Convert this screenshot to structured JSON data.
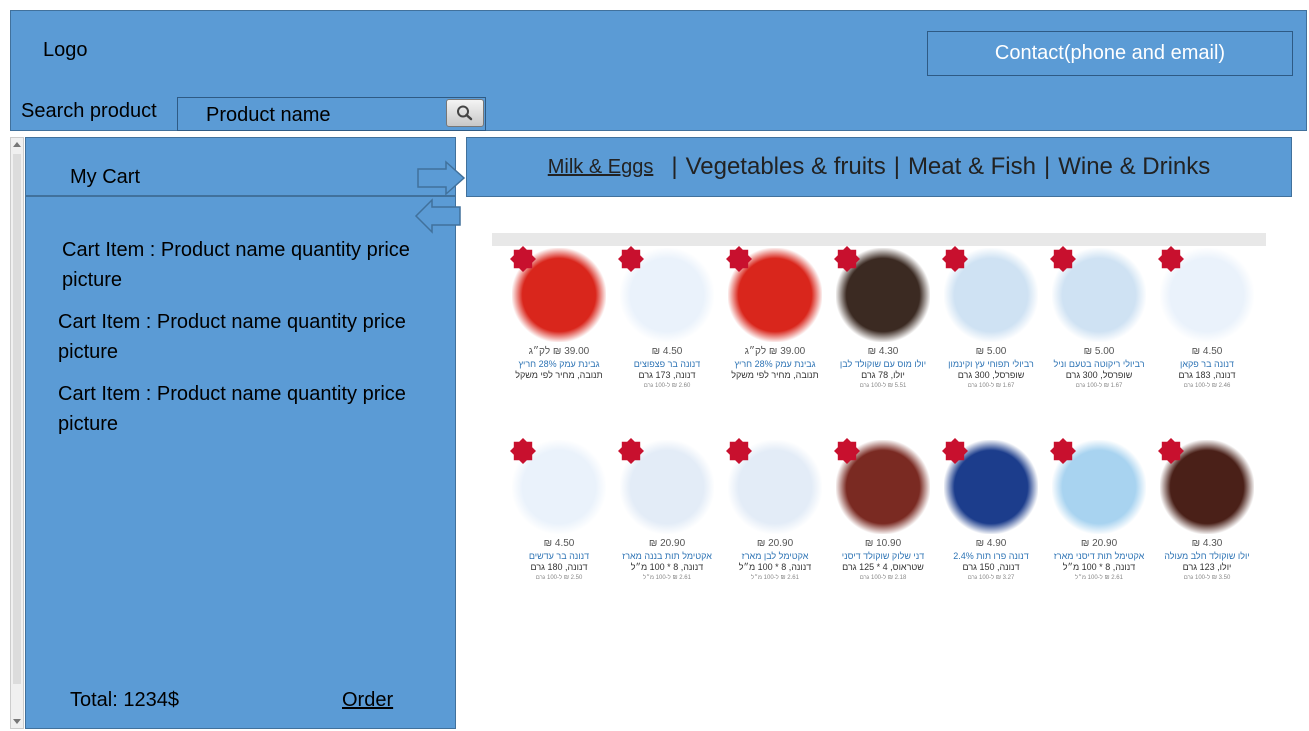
{
  "header": {
    "logo": "Logo",
    "contact": "Contact(phone and email)",
    "search_label": "Search product",
    "search_placeholder": "Product name"
  },
  "cart": {
    "title": "My Cart",
    "items": [
      {
        "line1": "Cart Item : Product name quantity price",
        "line2": "picture"
      },
      {
        "line1": "Cart Item : Product name quantity price",
        "line2": "picture"
      },
      {
        "line1": "Cart Item : Product name quantity price",
        "line2": "picture"
      }
    ],
    "total": "Total: 1234$",
    "order": "Order"
  },
  "categories": {
    "active": "Milk & Eggs",
    "separator": "|",
    "items": [
      "Vegetables & fruits",
      "Meat & Fish",
      "Wine & Drinks"
    ]
  },
  "products": [
    {
      "price": "39.00 ₪ לק״ג",
      "name": "גבינת עמק 28% חריץ",
      "sub": "תנובה, מחיר לפי משקל",
      "unit": "",
      "color": "#d9261c"
    },
    {
      "price": "4.50 ₪",
      "name": "דנונה בר פצפוצים",
      "sub": "דנונה, 173 גרם",
      "unit": "2.60 ₪ ל-100 גרם",
      "color": "#eaf2fb"
    },
    {
      "price": "39.00 ₪ לק״ג",
      "name": "גבינת עמק 28% חריץ",
      "sub": "תנובה, מחיר לפי משקל",
      "unit": "",
      "color": "#d9261c"
    },
    {
      "price": "4.30 ₪",
      "name": "יולו מוס עם שוקולד לבן",
      "sub": "יולו, 78 גרם",
      "unit": "5.51 ₪ ל-100 גרם",
      "color": "#3b2a22"
    },
    {
      "price": "5.00 ₪",
      "name": "רביולי תפוחי עץ וקינמון",
      "sub": "שופרסל, 300 גרם",
      "unit": "1.67 ₪ ל-100 גרם",
      "color": "#cfe2f3"
    },
    {
      "price": "5.00 ₪",
      "name": "רביולי ריקוטה בטעם וניל",
      "sub": "שופרסל, 300 גרם",
      "unit": "1.67 ₪ ל-100 גרם",
      "color": "#cfe2f3"
    },
    {
      "price": "4.50 ₪",
      "name": "דנונה בר פקאן",
      "sub": "דנונה, 183 גרם",
      "unit": "2.46 ₪ ל-100 גרם",
      "color": "#eaf2fb"
    },
    {
      "price": "4.50 ₪",
      "name": "דנונה בר עדשים",
      "sub": "דנונה, 180 גרם",
      "unit": "2.50 ₪ ל-100 גרם",
      "color": "#eaf2fb"
    },
    {
      "price": "20.90 ₪",
      "name": "אקטימל תות בננה מארז",
      "sub": "דנונה, 8 * 100 מ״ל",
      "unit": "2.61 ₪ ל-100 מ״ל",
      "color": "#e3ecf7"
    },
    {
      "price": "20.90 ₪",
      "name": "אקטימל לבן מארז",
      "sub": "דנונה, 8 * 100 מ״ל",
      "unit": "2.61 ₪ ל-100 מ״ל",
      "color": "#e3ecf7"
    },
    {
      "price": "10.90 ₪",
      "name": "דני שלוק שוקולד דיסני",
      "sub": "שטראוס, 4 * 125 גרם",
      "unit": "2.18 ₪ ל-100 גרם",
      "color": "#7a2a22"
    },
    {
      "price": "4.90 ₪",
      "name": "דנונה פרו תות 2.4%",
      "sub": "דנונה, 150 גרם",
      "unit": "3.27 ₪ ל-100 גרם",
      "color": "#1c3d8c"
    },
    {
      "price": "20.90 ₪",
      "name": "אקטימל תות דיסני מארז",
      "sub": "דנונה, 8 * 100 מ״ל",
      "unit": "2.61 ₪ ל-100 מ״ל",
      "color": "#a8d3f0"
    },
    {
      "price": "4.30 ₪",
      "name": "יולו שוקולד חלב מעולה",
      "sub": "יולו, 123 גרם",
      "unit": "3.50 ₪ ל-100 גרם",
      "color": "#4a2018"
    }
  ]
}
